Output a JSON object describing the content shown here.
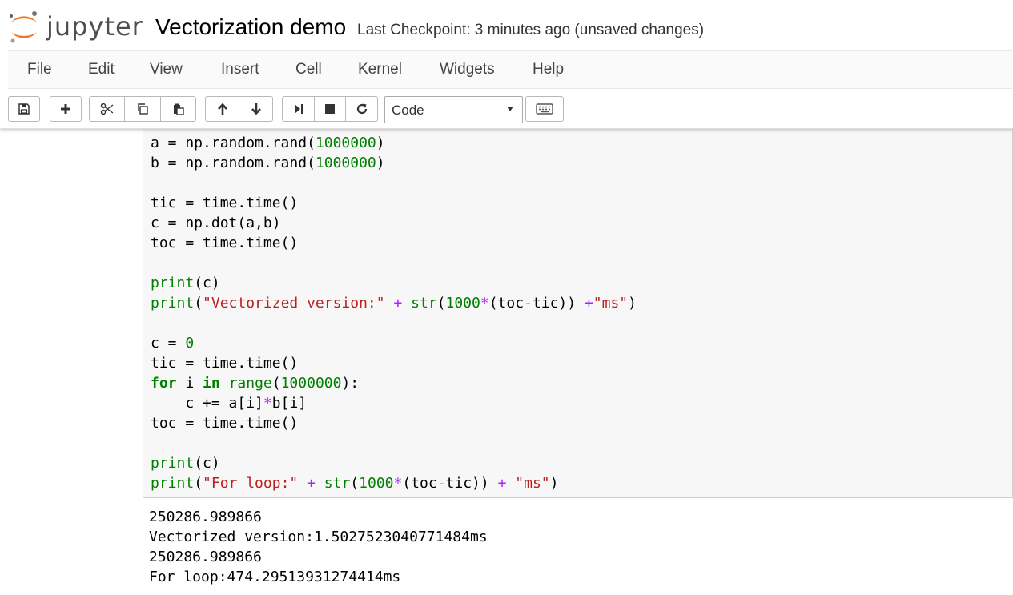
{
  "header": {
    "logo_text": "jupyter",
    "notebook_title": "Vectorization demo",
    "checkpoint": "Last Checkpoint: 3 minutes ago (unsaved changes)"
  },
  "menu": [
    "File",
    "Edit",
    "View",
    "Insert",
    "Cell",
    "Kernel",
    "Widgets",
    "Help"
  ],
  "toolbar": {
    "icons": [
      "save-icon",
      "plus-icon",
      "cut-icon",
      "copy-icon",
      "paste-icon",
      "arrow-up-icon",
      "arrow-down-icon",
      "run-icon",
      "stop-icon",
      "restart-icon",
      "keyboard-icon"
    ],
    "cell_type": "Code"
  },
  "code_lines": [
    [
      {
        "t": "a = np.random.rand("
      },
      {
        "t": "1000000",
        "c": "num"
      },
      {
        "t": ")"
      }
    ],
    [
      {
        "t": "b = np.random.rand("
      },
      {
        "t": "1000000",
        "c": "num"
      },
      {
        "t": ")"
      }
    ],
    [],
    [
      {
        "t": "tic = time.time()"
      }
    ],
    [
      {
        "t": "c = np.dot(a,b)"
      }
    ],
    [
      {
        "t": "toc = time.time()"
      }
    ],
    [],
    [
      {
        "t": "print",
        "c": "bi"
      },
      {
        "t": "(c)"
      }
    ],
    [
      {
        "t": "print",
        "c": "bi"
      },
      {
        "t": "("
      },
      {
        "t": "\"Vectorized version:\"",
        "c": "str"
      },
      {
        "t": " "
      },
      {
        "t": "+",
        "c": "op"
      },
      {
        "t": " "
      },
      {
        "t": "str",
        "c": "bi"
      },
      {
        "t": "("
      },
      {
        "t": "1000",
        "c": "num"
      },
      {
        "t": "*",
        "c": "op"
      },
      {
        "t": "(toc"
      },
      {
        "t": "-",
        "c": "op"
      },
      {
        "t": "tic)) "
      },
      {
        "t": "+",
        "c": "op"
      },
      {
        "t": "\"ms\"",
        "c": "str"
      },
      {
        "t": ")"
      }
    ],
    [],
    [
      {
        "t": "c = "
      },
      {
        "t": "0",
        "c": "num"
      }
    ],
    [
      {
        "t": "tic = time.time()"
      }
    ],
    [
      {
        "t": "for",
        "c": "kw"
      },
      {
        "t": " i "
      },
      {
        "t": "in",
        "c": "kw"
      },
      {
        "t": " "
      },
      {
        "t": "range",
        "c": "bi"
      },
      {
        "t": "("
      },
      {
        "t": "1000000",
        "c": "num"
      },
      {
        "t": "):"
      }
    ],
    [
      {
        "t": "    c += a[i]"
      },
      {
        "t": "*",
        "c": "op"
      },
      {
        "t": "b[i]"
      }
    ],
    [
      {
        "t": "toc = time.time()"
      }
    ],
    [],
    [
      {
        "t": "print",
        "c": "bi"
      },
      {
        "t": "(c)"
      }
    ],
    [
      {
        "t": "print",
        "c": "bi"
      },
      {
        "t": "("
      },
      {
        "t": "\"For loop:\"",
        "c": "str"
      },
      {
        "t": " "
      },
      {
        "t": "+",
        "c": "op"
      },
      {
        "t": " "
      },
      {
        "t": "str",
        "c": "bi"
      },
      {
        "t": "("
      },
      {
        "t": "1000",
        "c": "num"
      },
      {
        "t": "*",
        "c": "op"
      },
      {
        "t": "(toc"
      },
      {
        "t": "-",
        "c": "op"
      },
      {
        "t": "tic)) "
      },
      {
        "t": "+",
        "c": "op"
      },
      {
        "t": " "
      },
      {
        "t": "\"ms\"",
        "c": "str"
      },
      {
        "t": ")"
      }
    ]
  ],
  "output_lines": [
    "250286.989866",
    "Vectorized version:1.5027523040771484ms",
    "250286.989866",
    "For loop:474.29513931274414ms"
  ]
}
